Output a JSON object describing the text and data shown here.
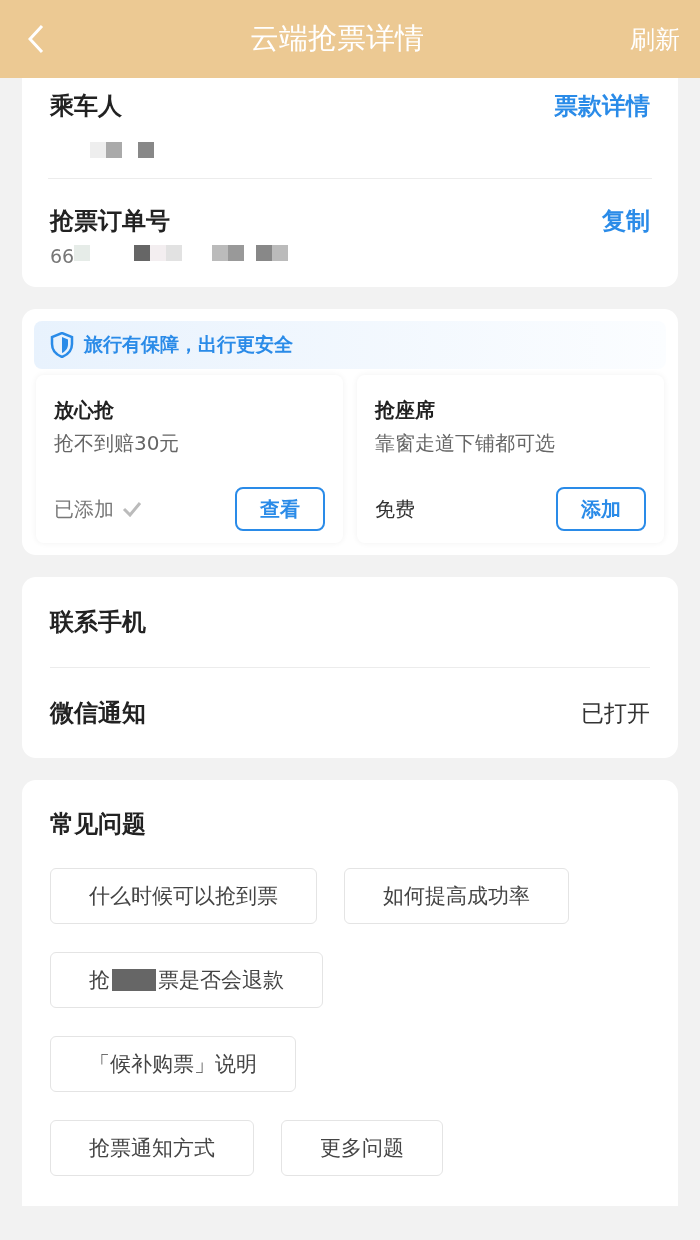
{
  "header": {
    "title": "云端抢票详情",
    "action": "刷新"
  },
  "order_card": {
    "passenger": {
      "label": "乘车人",
      "link": "票款详情"
    },
    "order_number": {
      "label": "抢票订单号",
      "link": "复制",
      "visible_prefix": "66"
    }
  },
  "service_card": {
    "banner": "旅行有保障，出行更安全",
    "options": [
      {
        "title": "放心抢",
        "subtitle": "抢不到赔30元",
        "status": "已添加",
        "added": true,
        "button": "查看"
      },
      {
        "title": "抢座席",
        "subtitle": "靠窗走道下铺都可选",
        "status": "免费",
        "added": false,
        "button": "添加"
      }
    ]
  },
  "contact_card": {
    "rows": [
      {
        "label": "联系手机"
      },
      {
        "label": "微信通知",
        "value": "已打开"
      }
    ]
  },
  "faq": {
    "title": "常见问题",
    "rows": [
      [
        {
          "kind": "plain",
          "label": "什么时候可以抢到票"
        },
        {
          "kind": "plain",
          "label": "如何提高成功率"
        }
      ],
      [
        {
          "kind": "masked",
          "parts": [
            "抢",
            "票是否会退款"
          ]
        }
      ],
      [
        {
          "kind": "plain",
          "label": "「候补购票」说明"
        }
      ],
      [
        {
          "kind": "plain",
          "label": "抢票通知方式"
        },
        {
          "kind": "plain",
          "label": "更多问题"
        }
      ]
    ]
  }
}
